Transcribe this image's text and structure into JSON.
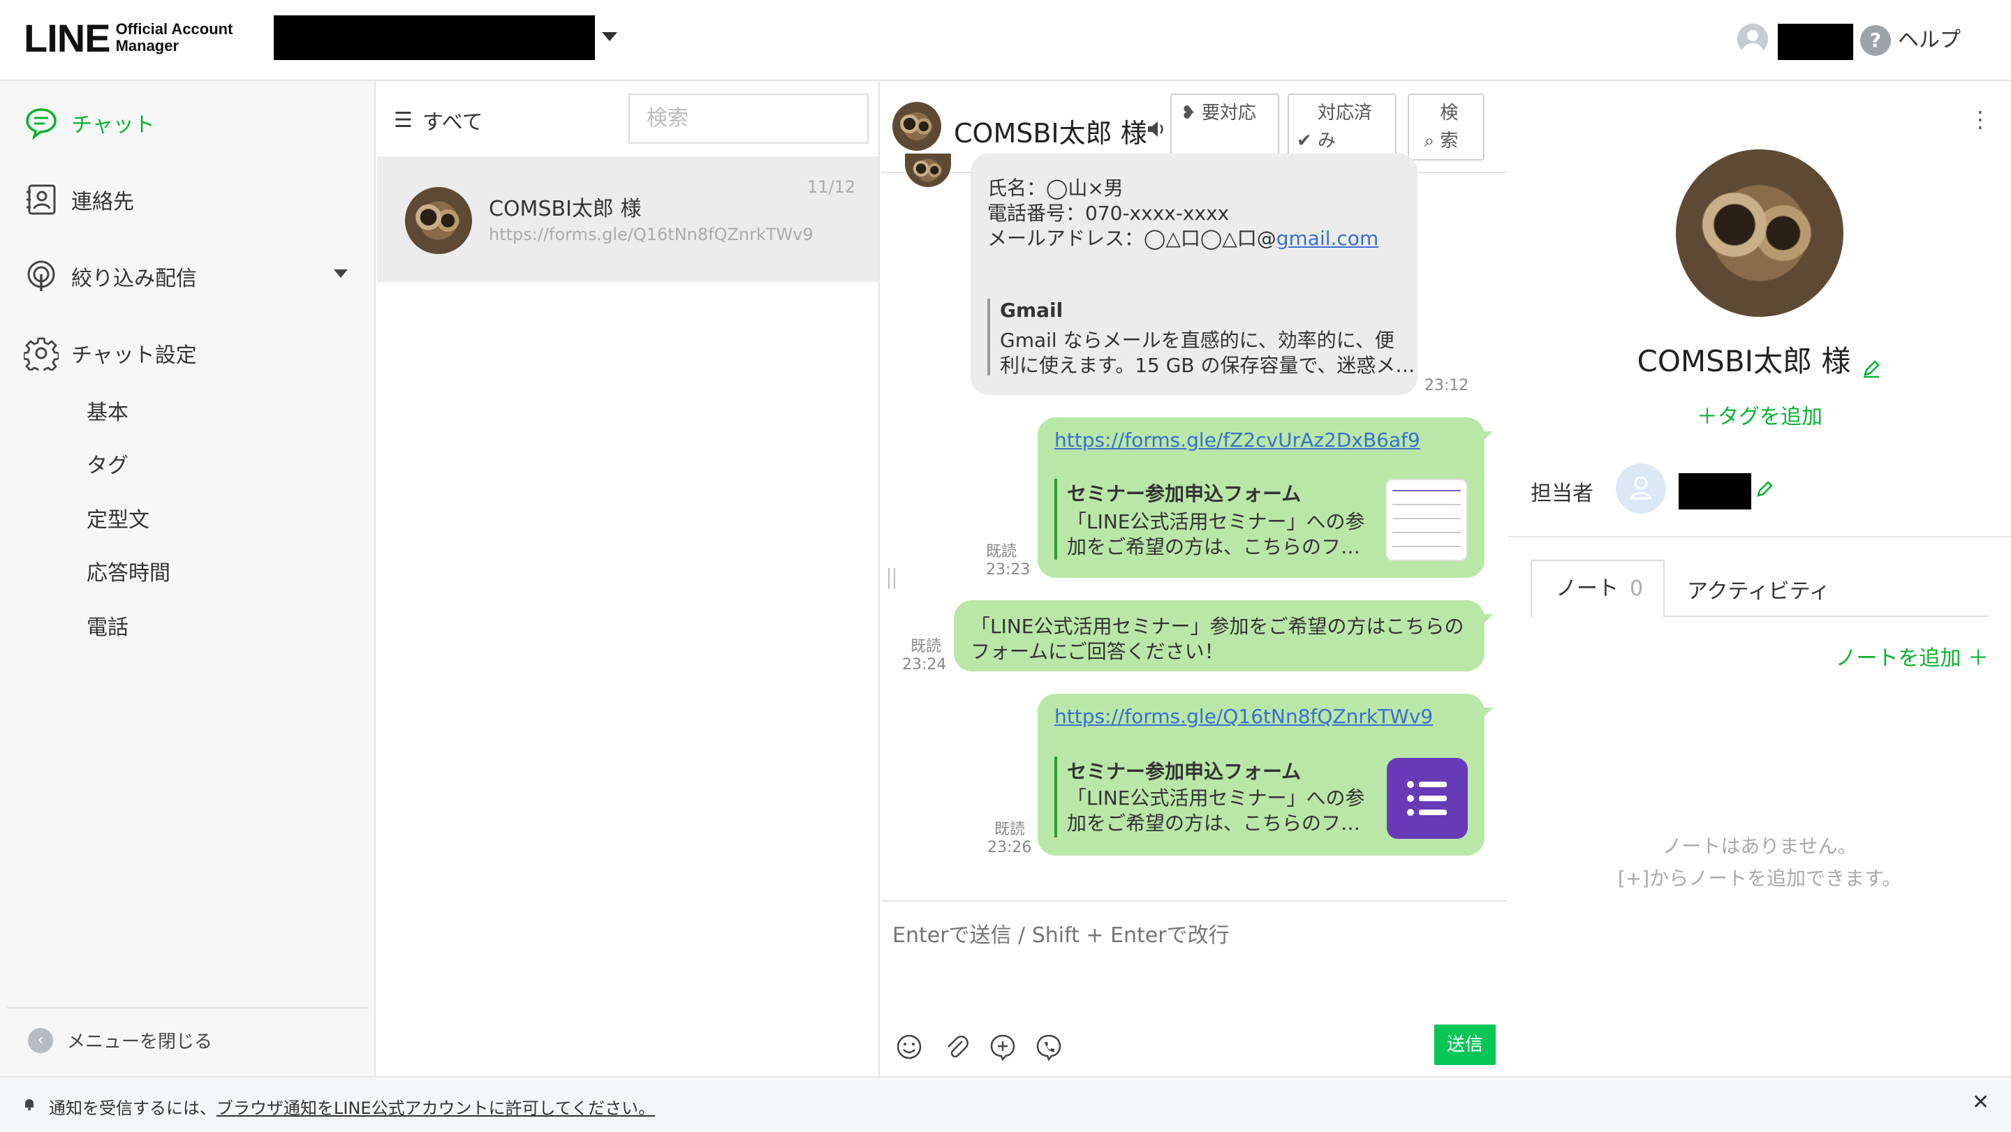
{
  "header": {
    "logo_main": "LINE",
    "logo_sub": "Official Account Manager",
    "help_label": "ヘルプ"
  },
  "sidebar": {
    "items": [
      {
        "label": "チャット",
        "icon": "chat-bubble-icon",
        "active": true
      },
      {
        "label": "連絡先",
        "icon": "contact-card-icon"
      },
      {
        "label": "絞り込み配信",
        "icon": "broadcast-icon"
      },
      {
        "label": "チャット設定",
        "icon": "gear-icon"
      }
    ],
    "subitems": [
      "基本",
      "タグ",
      "定型文",
      "応答時間",
      "電話"
    ],
    "close_menu": "メニューを閉じる"
  },
  "chatlist": {
    "filter_label": "すべて",
    "search_placeholder": "検索",
    "rows": [
      {
        "name": "COMSBI太郎 様",
        "preview": "https://forms.gle/Q16tNn8fQZnrkTWv9",
        "date": "11/12"
      }
    ]
  },
  "chat": {
    "title": "COMSBI太郎 様",
    "buttons": [
      {
        "label": "要対応",
        "icon": "flag-icon"
      },
      {
        "label": "対応済み",
        "icon": "check-bubble-icon"
      },
      {
        "label": "検索",
        "icon": "search-icon"
      }
    ],
    "incoming": {
      "lines": [
        "氏名：◯山×男",
        "電話番号：070-xxxx-xxxx"
      ],
      "email_prefix": "メールアドレス：◯△口◯△口@",
      "email_link": "gmail.com",
      "card_title": "Gmail",
      "card_desc": [
        "Gmail ならメールを直感的に、効率的に、便",
        "利に使えます。15 GB の保存容量で、迷惑メ…"
      ],
      "time": "23:12"
    },
    "outgoing": [
      {
        "link": "https://forms.gle/fZ2cvUrAz2DxB6af9",
        "card_title": "セミナー参加申込フォーム",
        "card_desc": [
          "「LINE公式活用セミナー」への参",
          "加をご希望の方は、こちらのフ…"
        ],
        "read": "既読",
        "time": "23:23"
      },
      {
        "text": [
          "「LINE公式活用セミナー」参加をご希望の方はこちらの",
          "フォームにご回答ください！"
        ],
        "read": "既読",
        "time": "23:24"
      },
      {
        "link": "https://forms.gle/Q16tNn8fQZnrkTWv9",
        "card_title": "セミナー参加申込フォーム",
        "card_desc": [
          "「LINE公式活用セミナー」への参",
          "加をご希望の方は、こちらのフ…"
        ],
        "read": "既読",
        "time": "23:26"
      }
    ],
    "composer_placeholder": "Enterで送信 / Shift + Enterで改行",
    "send_label": "送信"
  },
  "profile": {
    "name": "COMSBI太郎 様",
    "add_tag": "＋タグを追加",
    "assignee_label": "担当者",
    "tabs": [
      {
        "label": "ノート",
        "count": "0"
      },
      {
        "label": "アクティビティ"
      }
    ],
    "add_note": "ノートを追加 ＋",
    "empty_lines": [
      "ノートはありません。",
      "[+]からノートを追加できます。"
    ]
  },
  "notification": {
    "prefix": "通知を受信するには、",
    "link": "ブラウザ通知をLINE公式アカウントに許可してください。"
  },
  "colors": {
    "accent": "#06c755",
    "outgoing_bubble": "#b9e7a8",
    "incoming_bubble": "#ececec"
  }
}
